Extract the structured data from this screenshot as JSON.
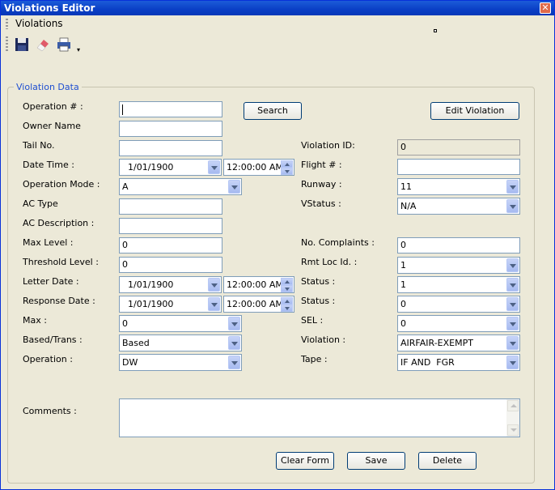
{
  "window": {
    "title": "Violations Editor",
    "close_glyph": "✕"
  },
  "menu": {
    "violations": "Violations"
  },
  "toolbar": {
    "icons": [
      "save-icon",
      "eraser-icon",
      "print-icon"
    ],
    "dropdown_glyph": "▾"
  },
  "group": {
    "title": "Violation Data"
  },
  "labels": {
    "operation_no": "Operation # :",
    "owner_name": "Owner Name",
    "tail_no": "Tail No.",
    "date_time": "Date Time :",
    "operation_mode": "Operation Mode :",
    "ac_type": "AC Type",
    "ac_description": "AC Description :",
    "max_level": "Max Level :",
    "threshold_level": "Threshold Level :",
    "letter_date": "Letter Date :",
    "response_date": "Response Date :",
    "max": "Max :",
    "based_trans": "Based/Trans :",
    "operation": "Operation :",
    "comments": "Comments :",
    "violation_id": "Violation ID:",
    "flight_no": "Flight # :",
    "runway": "Runway :",
    "vstatus": "VStatus :",
    "no_complaints": "No. Complaints :",
    "rmt_loc_id": "Rmt Loc Id. :",
    "status1": "Status :",
    "status2": "Status :",
    "sel": "SEL :",
    "violation": "Violation :",
    "tape": "Tape :"
  },
  "values": {
    "operation_no": "",
    "owner_name": "",
    "tail_no": "",
    "date": "1/01/1900",
    "time": "12:00:00 AM",
    "operation_mode": "A",
    "ac_type": "",
    "ac_description": "",
    "max_level": "0",
    "threshold_level": "0",
    "letter_date": "1/01/1900",
    "letter_time": "12:00:00 AM",
    "response_date": "1/01/1900",
    "response_time": "12:00:00 AM",
    "max": "0",
    "based_trans": "Based",
    "operation": "DW",
    "comments": "",
    "violation_id": "0",
    "flight_no": "",
    "runway": "11",
    "vstatus": "N/A",
    "no_complaints": "0",
    "rmt_loc_id": "1",
    "status1": "1",
    "status2": "0",
    "sel": "0",
    "violation": "AIRFAIR-EXEMPT",
    "tape": "IF AND  FGR"
  },
  "buttons": {
    "search": "Search",
    "edit_violation": "Edit Violation",
    "clear_form": "Clear Form",
    "save": "Save",
    "delete": "Delete"
  }
}
